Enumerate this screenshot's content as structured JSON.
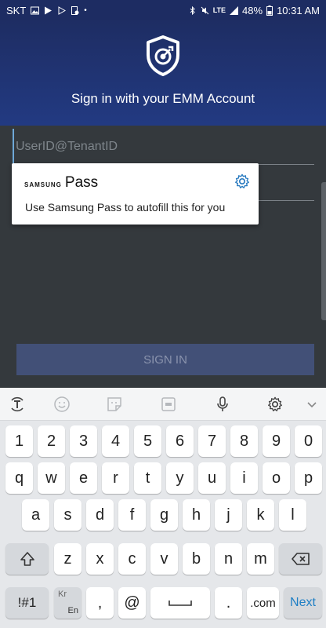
{
  "status_bar": {
    "carrier": "SKT",
    "lte": "LTE",
    "battery": "48%",
    "time": "10:31 AM"
  },
  "header": {
    "title": "Sign in with your EMM Account"
  },
  "form": {
    "username_placeholder": "UserID@TenantID",
    "password_placeholder": "",
    "signin_label": "SIGN IN"
  },
  "autofill_popup": {
    "brand_small": "SAMSUNG",
    "brand_large": "Pass",
    "message": "Use Samsung Pass to autofill this for you"
  },
  "keyboard": {
    "toolbar_icons": [
      "translate-icon",
      "emoji-icon",
      "sticker-icon",
      "gif-icon",
      "microphone-icon",
      "settings-icon",
      "collapse-icon"
    ],
    "row_numbers": [
      "1",
      "2",
      "3",
      "4",
      "5",
      "6",
      "7",
      "8",
      "9",
      "0"
    ],
    "row1": [
      "q",
      "w",
      "e",
      "r",
      "t",
      "y",
      "u",
      "i",
      "o",
      "p"
    ],
    "row2": [
      "a",
      "s",
      "d",
      "f",
      "g",
      "h",
      "j",
      "k",
      "l"
    ],
    "row3": [
      "z",
      "x",
      "c",
      "v",
      "b",
      "n",
      "m"
    ],
    "symbols_key": "!#1",
    "lang_key_top": "Kr",
    "lang_key_bottom": "En",
    "comma_key": ",",
    "at_key": "@",
    "period_key": ".",
    "com_key": ".com",
    "next_key": "Next"
  },
  "colors": {
    "header_top": "#1e2d63",
    "header_bottom": "#223a82",
    "form_bg": "#34393d",
    "signin_button": "#425077",
    "next_accent": "#1f7fc5"
  }
}
